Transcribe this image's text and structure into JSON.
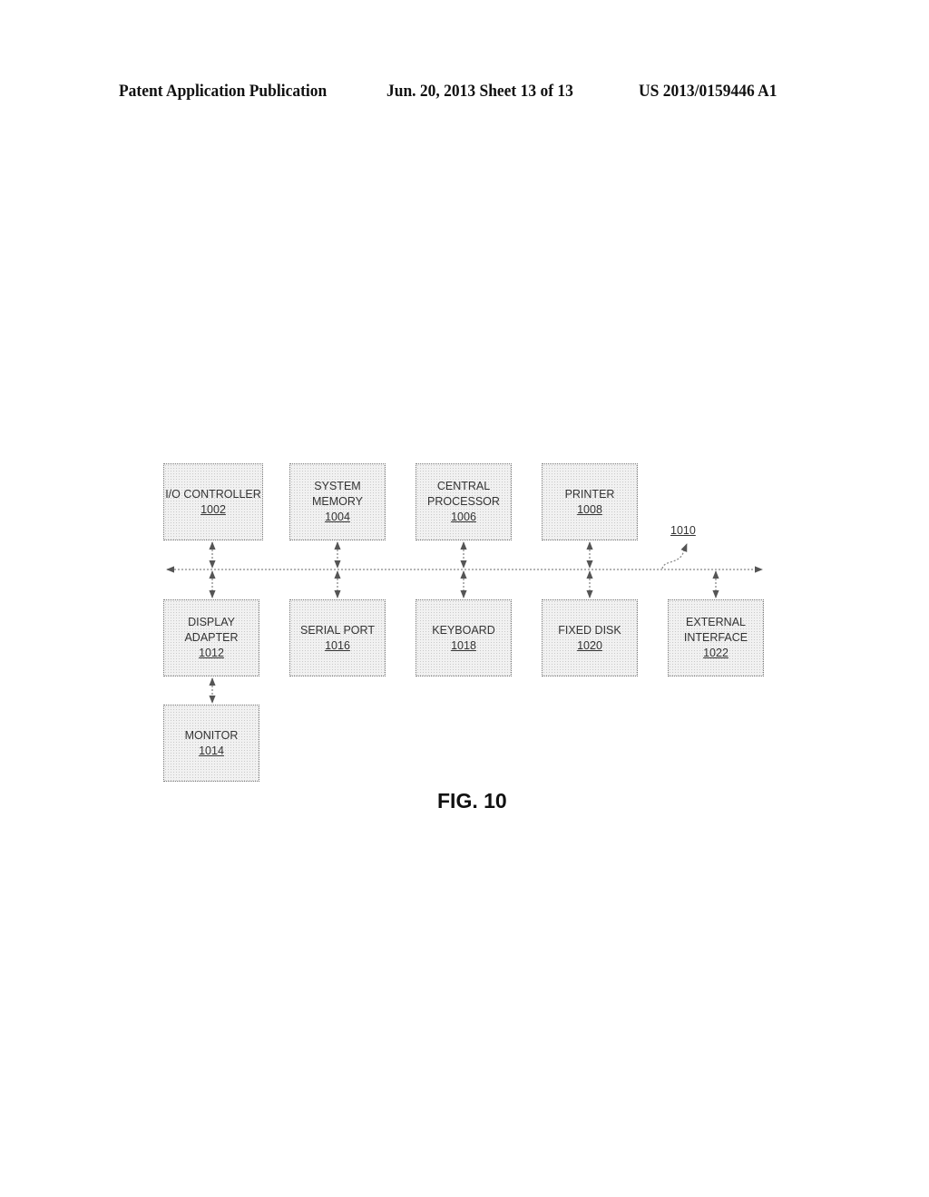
{
  "header": {
    "left": "Patent Application Publication",
    "middle": "Jun. 20, 2013  Sheet 13 of 13",
    "right": "US 2013/0159446 A1"
  },
  "figure": {
    "label": "FIG. 10",
    "bus_ref": "1010",
    "blocks": {
      "io_controller": {
        "lines": [
          "I/O CONTROLLER"
        ],
        "num": "1002"
      },
      "system_memory": {
        "lines": [
          "SYSTEM",
          "MEMORY"
        ],
        "num": "1004"
      },
      "central_processor": {
        "lines": [
          "CENTRAL",
          "PROCESSOR"
        ],
        "num": "1006"
      },
      "printer": {
        "lines": [
          "PRINTER"
        ],
        "num": "1008"
      },
      "display_adapter": {
        "lines": [
          "DISPLAY",
          "ADAPTER"
        ],
        "num": "1012"
      },
      "serial_port": {
        "lines": [
          "SERIAL PORT"
        ],
        "num": "1016"
      },
      "keyboard": {
        "lines": [
          "KEYBOARD"
        ],
        "num": "1018"
      },
      "fixed_disk": {
        "lines": [
          "FIXED DISK"
        ],
        "num": "1020"
      },
      "external_interface": {
        "lines": [
          "EXTERNAL",
          "INTERFACE"
        ],
        "num": "1022"
      },
      "monitor": {
        "lines": [
          "MONITOR"
        ],
        "num": "1014"
      }
    }
  }
}
